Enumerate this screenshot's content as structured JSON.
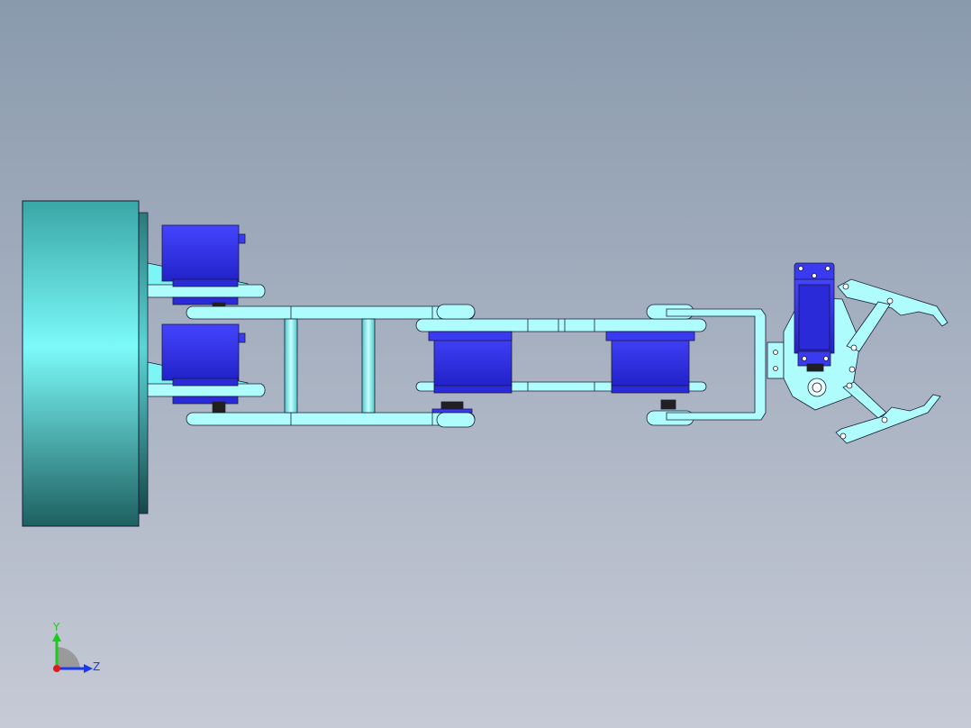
{
  "viewport": {
    "background_top": "#8a9aad",
    "background_bottom": "#c6cad6"
  },
  "colors": {
    "part_cyan": "#7ef5f5",
    "part_cyan_light": "#aefcfc",
    "part_cyan_dark": "#3aa0a0",
    "servo_blue": "#3a3af0",
    "servo_blue_dark": "#1a1ab0",
    "edge": "#1b1b3a"
  },
  "triad": {
    "y_label": "Y",
    "z_label": "Z",
    "y_color": "#1ccc1c",
    "z_color": "#1a3aee",
    "origin_color": "#e01a1a"
  }
}
